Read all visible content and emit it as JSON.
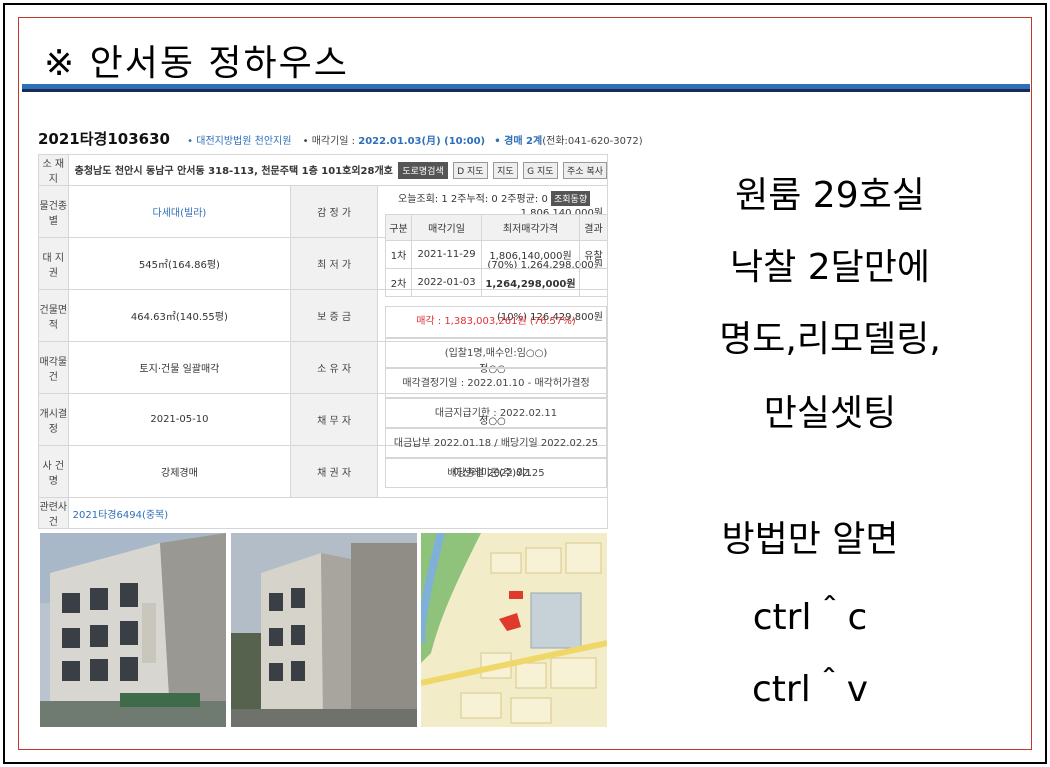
{
  "title": "※ 안서동 정하우스",
  "auction": {
    "case_no_prefix": "2021타경",
    "case_no": "103630",
    "court": "• 대전지방법원 천안지원",
    "sale_date_label": "• 매각기일 :",
    "sale_date": "2022.01.03(月) (10:00)",
    "dept": "• 경매 2계",
    "phone": "(전화:041-620-3072)",
    "rows": {
      "addr_label": "소 재 지",
      "addr_value": "충청남도 천안시 동남구 안서동 318-113, 천문주택 1층 101호외28개호",
      "btn_road": "도로명검색",
      "btn_map1": "D 지도",
      "btn_map2": "지도",
      "btn_map3": "G 지도",
      "btn_copy": "주소 복사",
      "type_label": "물건종별",
      "type_value": "다세대(빌라)",
      "appraise_label": "감 정 가",
      "appraise_value": "1,806,140,000원",
      "land_label": "대 지 권",
      "land_value": "545㎡(164.86평)",
      "min_label": "최 저 가",
      "min_value": "(70%) 1,264,298,000원",
      "bldg_label": "건물면적",
      "bldg_value": "464.63㎡(140.55평)",
      "deposit_label": "보 증 금",
      "deposit_value": "(10%) 126,429,800원",
      "sale_obj_label": "매각물건",
      "sale_obj_value": "토지·건물 일괄매각",
      "owner_label": "소 유 자",
      "owner_value": "정○○",
      "start_label": "개시결정",
      "start_value": "2021-05-10",
      "debtor_label": "채 무 자",
      "debtor_value": "정○○",
      "case_label": "사 건 명",
      "case_value": "강제경매",
      "creditor_label": "채 권 자",
      "creditor_value": "아산레미콘(주)외1",
      "related_label": "관련사건",
      "related_value": "2021타경6494(중복)"
    },
    "today": "오늘조회: 1  2주누적: 0  2주평균: 0",
    "today_btn": "조회동향",
    "history_headers": [
      "구분",
      "매각기일",
      "최저매각가격",
      "결과"
    ],
    "history": [
      {
        "round": "1차",
        "date": "2021-11-29",
        "price": "1,806,140,000원",
        "result": "유찰"
      },
      {
        "round": "2차",
        "date": "2022-01-03",
        "price": "1,264,298,000원",
        "result": ""
      }
    ],
    "sale_price_label": "매각 : 1,383,003,261원",
    "sale_rate": "(76.57%)",
    "notes": [
      "(입찰1명,매수인:임○○)",
      "매각결정기일 : 2022.01.10 - 매각허가결정",
      "대금지급기한 : 2022.02.11",
      "대금납부 2022.01.18 / 배당기일 2022.02.25",
      "배당종결 2022.02.25"
    ]
  },
  "right_lines": [
    "원룸 29호실",
    "낙찰 2달만에",
    "명도,리모델링,",
    "만실셋팅"
  ],
  "right_lines2": [
    "방법만 알면",
    "ctrl＾c",
    "ctrl＾v"
  ],
  "colors": {
    "accent_blue": "#2e6fba",
    "navy": "#1b2b4f",
    "frame_red": "#c0392b",
    "sale_red": "#dd3333"
  }
}
